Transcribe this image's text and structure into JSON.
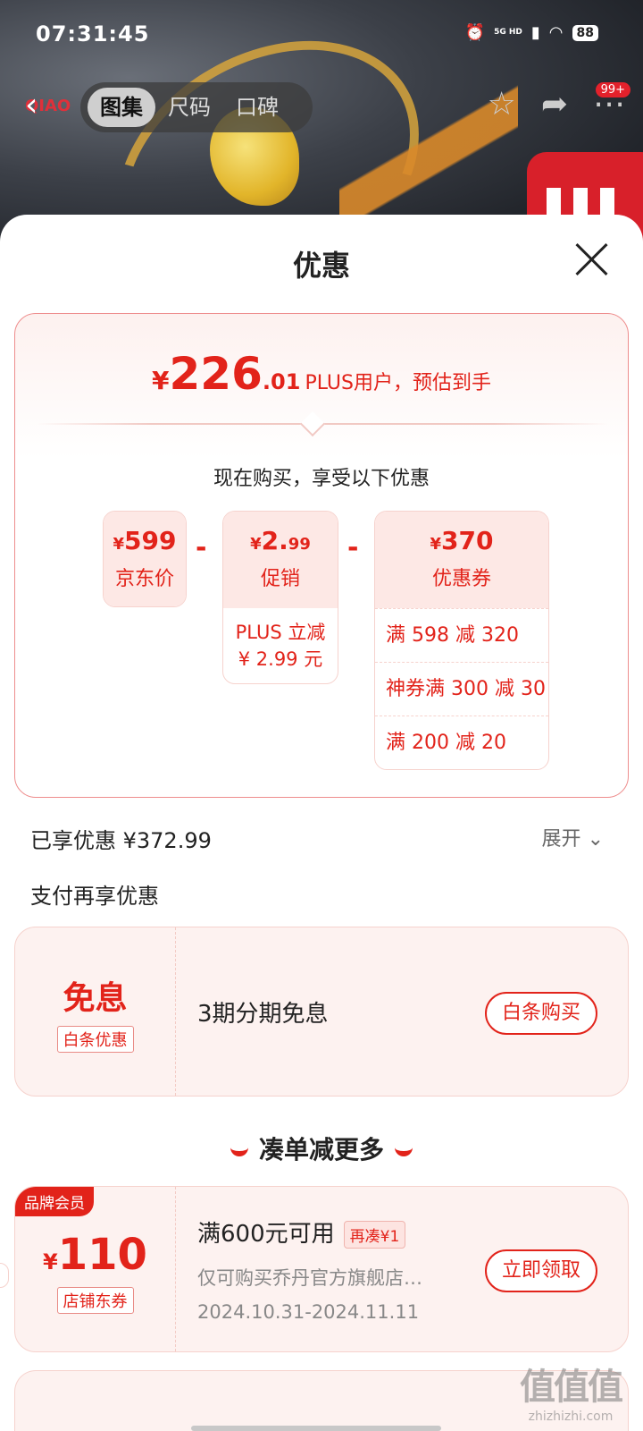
{
  "status_bar": {
    "time": "07:31:45",
    "network": "5G HD",
    "battery": "88"
  },
  "nav": {
    "logo": "QIAO",
    "tabs": [
      {
        "label": "图集",
        "active": true
      },
      {
        "label": "尺码",
        "active": false
      },
      {
        "label": "口碑",
        "active": false
      }
    ],
    "cart_badge": "99+"
  },
  "sheet": {
    "title": "优惠",
    "estimate": {
      "currency": "¥",
      "integer": "226",
      "decimal": ".01",
      "note": "PLUS用户，预估到手"
    },
    "subtitle": "现在购买，享受以下优惠",
    "breakdown": {
      "jd_price": {
        "currency": "¥",
        "value": "599",
        "label": "京东价"
      },
      "promo": {
        "currency": "¥",
        "value": "2.",
        "value_small": "99",
        "label": "促销",
        "detail": "PLUS 立减 ¥ 2.99 元"
      },
      "coupon": {
        "currency": "¥",
        "value": "370",
        "label": "优惠券",
        "rows": [
          "满 598 减 320",
          "神券满 300 减 30",
          "满 200 减 20"
        ]
      },
      "operator": "-"
    },
    "saved": "已享优惠 ¥372.99",
    "expand_label": "展开",
    "pay_title": "支付再享优惠",
    "pay_offer": {
      "big": "免息",
      "tag": "白条优惠",
      "text": "3期分期免息",
      "button": "白条购买"
    },
    "more_title": "凑单减更多",
    "coupon": {
      "ribbon": "品牌会员",
      "currency": "¥",
      "amount": "110",
      "tag": "店铺东券",
      "condition": "满600元可用",
      "extra": "再凑¥1",
      "description": "仅可购买乔丹官方旗舰店…",
      "date_range": "2024.10.31-2024.11.11",
      "button": "立即领取"
    }
  },
  "watermark": {
    "logo": "值值值",
    "text": "zhizhizhi.com"
  },
  "colors": {
    "accent": "#e2231a",
    "soft_bg": "#fdf2f0",
    "border": "#f6d2cd"
  }
}
